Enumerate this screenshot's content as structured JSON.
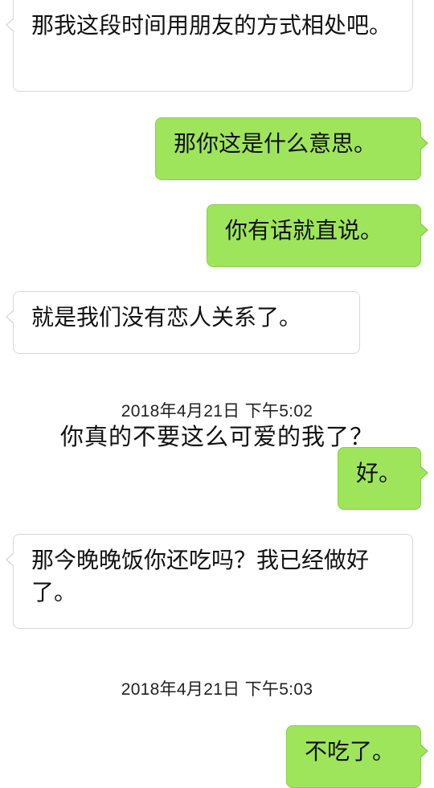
{
  "messages": [
    {
      "side": "left",
      "text": "那我这段时间用朋友的方式相处吧。"
    },
    {
      "side": "right",
      "text": "那你这是什么意思。"
    },
    {
      "side": "right",
      "text": "你有话就直说。"
    },
    {
      "side": "left",
      "text": "就是我们没有恋人关系了。"
    },
    {
      "side": "right",
      "text": "好。"
    },
    {
      "side": "left",
      "text": "那今晚晚饭你还吃吗？我已经做好了。"
    },
    {
      "side": "right",
      "text": "不吃了。"
    }
  ],
  "timestamps": [
    "2018年4月21日 下午5:02",
    "2018年4月21日 下午5:03"
  ],
  "caption": "你真的不要这么可爱的我了？",
  "colors": {
    "right_bubble": "#9ee55c",
    "left_bubble": "#ffffff",
    "background": "#ffffff"
  }
}
